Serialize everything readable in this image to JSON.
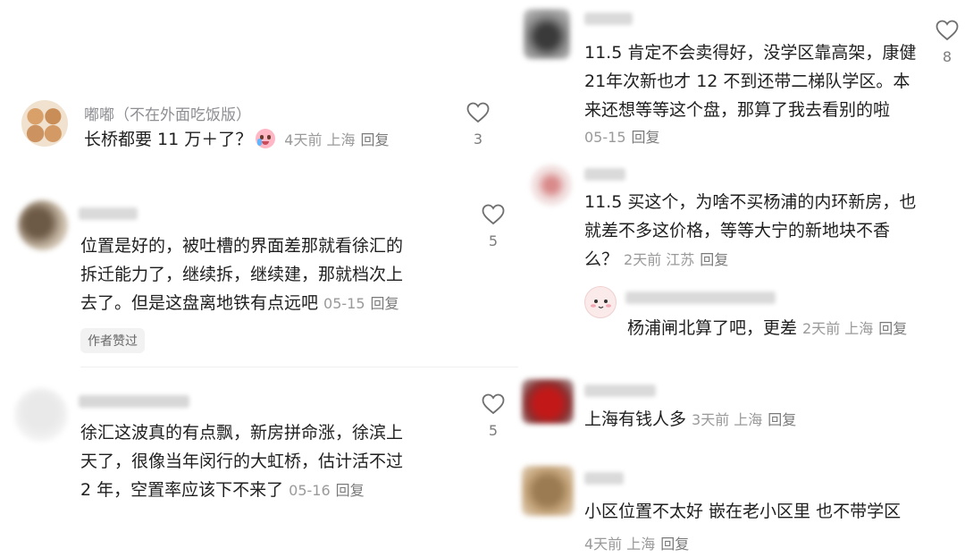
{
  "left": {
    "c1": {
      "username": "嘟嘟（不在外面吃饭版）",
      "text": "长桥都要 11 万＋了？",
      "meta": "4天前 上海",
      "reply": "回复",
      "likes": "3"
    },
    "c2": {
      "line1": "位置是好的，被吐槽的界面差那就看徐汇的",
      "line2": "拆迁能力了，继续拆，继续建，那就档次上",
      "line3": "去了。但是这盘离地铁有点远吧",
      "meta": "05-15",
      "reply": "回复",
      "likes": "5",
      "badge": "作者赞过"
    },
    "c3": {
      "line1": "徐汇这波真的有点飘，新房拼命涨，徐滨上",
      "line2": "天了，很像当年闵行的大虹桥，估计活不过",
      "line3": "2 年，空置率应该下不来了",
      "meta": "05-16",
      "reply": "回复",
      "likes": "5"
    }
  },
  "right": {
    "r1": {
      "line1": "11.5 肯定不会卖得好，没学区靠高架，康健",
      "line2": "21年次新也才 12 不到还带二梯队学区。本",
      "line3": "来还想等等这个盘，那算了我去看别的啦",
      "meta": "05-15",
      "reply": "回复",
      "likes": "8"
    },
    "r2": {
      "line1": "11.5 买这个，为啥不买杨浦的内环新房，也",
      "line2": "就差不多这价格，等等大宁的新地块不香",
      "line3": "么？",
      "meta": "2天前 江苏",
      "reply": "回复"
    },
    "r2reply": {
      "text": "杨浦闸北算了吧，更差",
      "meta": "2天前 上海",
      "reply": "回复"
    },
    "r3": {
      "text": "上海有钱人多",
      "meta": "3天前 上海",
      "reply": "回复"
    },
    "r4": {
      "text": "小区位置不太好 嵌在老小区里 也不带学区",
      "meta": "4天前 上海",
      "reply": "回复"
    }
  },
  "icons": {
    "like": "heart-outline-icon",
    "emoji": "crying-face-emoji-icon"
  }
}
